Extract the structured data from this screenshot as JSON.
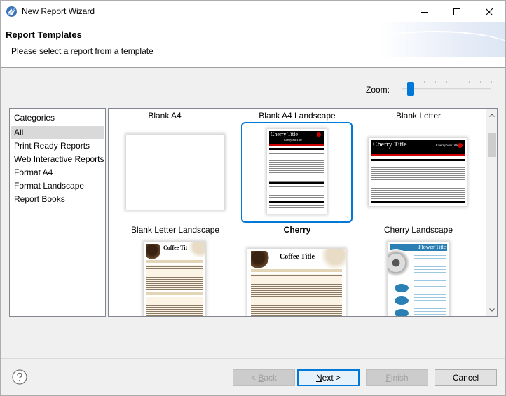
{
  "window": {
    "title": "New Report Wizard",
    "icon": "eclipse-birt-icon"
  },
  "header": {
    "title": "Report Templates",
    "message": "Please select a report from a template"
  },
  "zoom": {
    "label": "Zoom:",
    "level_fraction": 0.1
  },
  "categories": {
    "header": "Categories",
    "items": [
      {
        "label": "All",
        "selected": true
      },
      {
        "label": "Print Ready Reports",
        "selected": false
      },
      {
        "label": "Web Interactive Reports",
        "selected": false
      },
      {
        "label": "Format A4",
        "selected": false
      },
      {
        "label": "Format Landscape",
        "selected": false
      },
      {
        "label": "Report Books",
        "selected": false
      }
    ]
  },
  "templates": [
    {
      "label": "Blank A4",
      "selected": false
    },
    {
      "label": "Blank A4 Landscape",
      "selected": false
    },
    {
      "label": "Blank Letter",
      "selected": false
    },
    {
      "label": "Blank Letter Landscape",
      "selected": false
    },
    {
      "label": "Cherry",
      "selected": true
    },
    {
      "label": "Cherry Landscape",
      "selected": false
    }
  ],
  "thumbnails": {
    "cherry_title": "Cherry Title",
    "cherry_subtitle": "Cherry SubTitle",
    "coffee_title": "Coffee Title",
    "flower_title": "Flower Title"
  },
  "buttons": {
    "back_prefix": "< ",
    "back_key": "B",
    "back_rest": "ack",
    "next_key": "N",
    "next_rest": "ext >",
    "finish_key": "F",
    "finish_rest": "inish",
    "cancel": "Cancel"
  },
  "colors": {
    "accent": "#0078d7",
    "cherry_red": "#cc0000",
    "coffee_brown": "#5a3a22",
    "flower_blue": "#2a7fb4"
  }
}
